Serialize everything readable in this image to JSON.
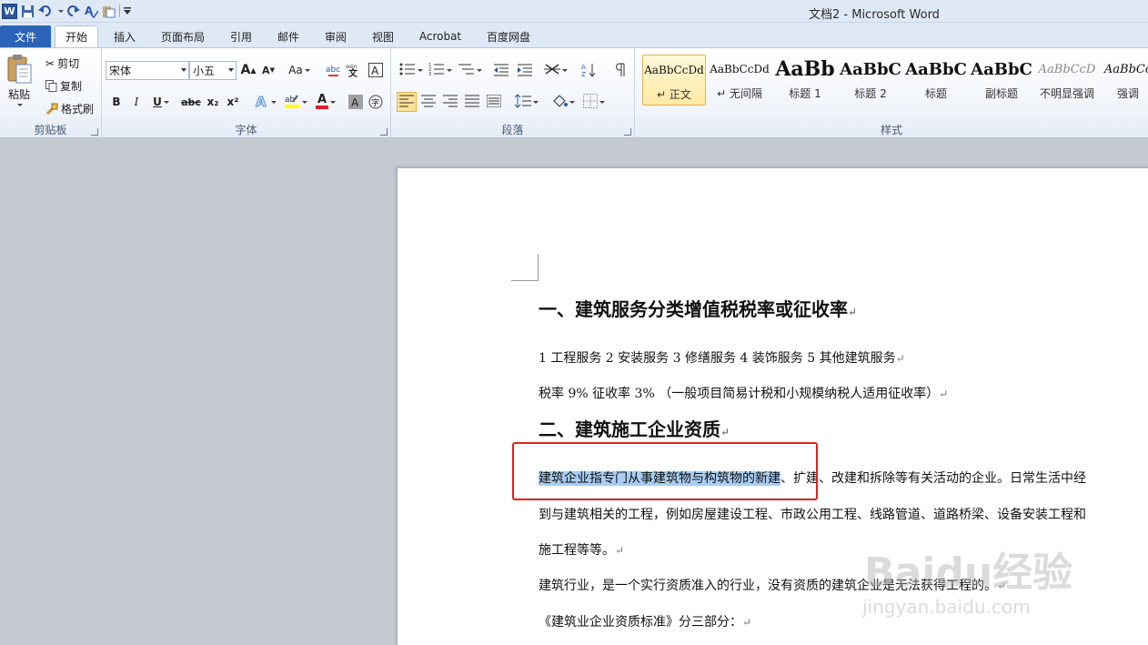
{
  "window": {
    "title": "文档2  -  Microsoft Word",
    "app_icon_letter": "W"
  },
  "quick_access": [
    "save-icon",
    "undo-icon",
    "redo-icon",
    "spelling-icon",
    "paste-icon",
    "customize-icon"
  ],
  "tabs": [
    {
      "label": "文件"
    },
    {
      "label": "开始"
    },
    {
      "label": "插入"
    },
    {
      "label": "页面布局"
    },
    {
      "label": "引用"
    },
    {
      "label": "邮件"
    },
    {
      "label": "审阅"
    },
    {
      "label": "视图"
    },
    {
      "label": "Acrobat"
    },
    {
      "label": "百度网盘"
    }
  ],
  "clipboard": {
    "label": "剪贴板",
    "paste": "粘贴",
    "cut": "剪切",
    "copy": "复制",
    "format_painter": "格式刷"
  },
  "font": {
    "label": "字体",
    "family": "宋体",
    "size": "小五",
    "grow": "A",
    "shrink": "A",
    "case": "Aa",
    "bold": "B",
    "italic": "I",
    "underline": "U",
    "strike": "abc",
    "subscript": "x₂",
    "superscript": "x²",
    "font_color": "A"
  },
  "paragraph": {
    "label": "段落"
  },
  "styles": {
    "label": "样式",
    "items": [
      {
        "preview": "AaBbCcDd",
        "name": "↵ 正文"
      },
      {
        "preview": "AaBbCcDd",
        "name": "↵ 无间隔"
      },
      {
        "preview": "AaBb",
        "name": "标题 1"
      },
      {
        "preview": "AaBbC",
        "name": "标题 2"
      },
      {
        "preview": "AaBbC",
        "name": "标题"
      },
      {
        "preview": "AaBbC",
        "name": "副标题"
      },
      {
        "preview": "AaBbCcD",
        "name": "不明显强调"
      },
      {
        "preview": "AaBbCc",
        "name": "强调"
      }
    ]
  },
  "document": {
    "heading1": "一、建筑服务分类增值税税率或征收率",
    "line1": "1   工程服务  2   安装服务  3   修缮服务  4   装饰服务  5   其他建筑服务",
    "line2": "税率 9%   征收率 3%  （一般项目简易计税和小规模纳税人适用征收率）",
    "heading2": "二、建筑施工企业资质",
    "p1_highlight": "建筑企业指专门从事建筑物与构筑物的新建",
    "p1_rest": "、扩建、改建和拆除等有关活动的企业。日常生活中经",
    "p2": "到与建筑相关的工程，例如房屋建设工程、市政公用工程、线路管道、道路桥梁、设备安装工程和",
    "p3": "施工程等等。",
    "p4": "建筑行业，是一个实行资质准入的行业，没有资质的建筑企业是无法获得工程的。",
    "p5": "《建筑业企业资质标准》分三部分：",
    "para_mark": "↵"
  },
  "watermark": {
    "text": "Baidu经验",
    "sub": "jingyan.baidu.com"
  }
}
